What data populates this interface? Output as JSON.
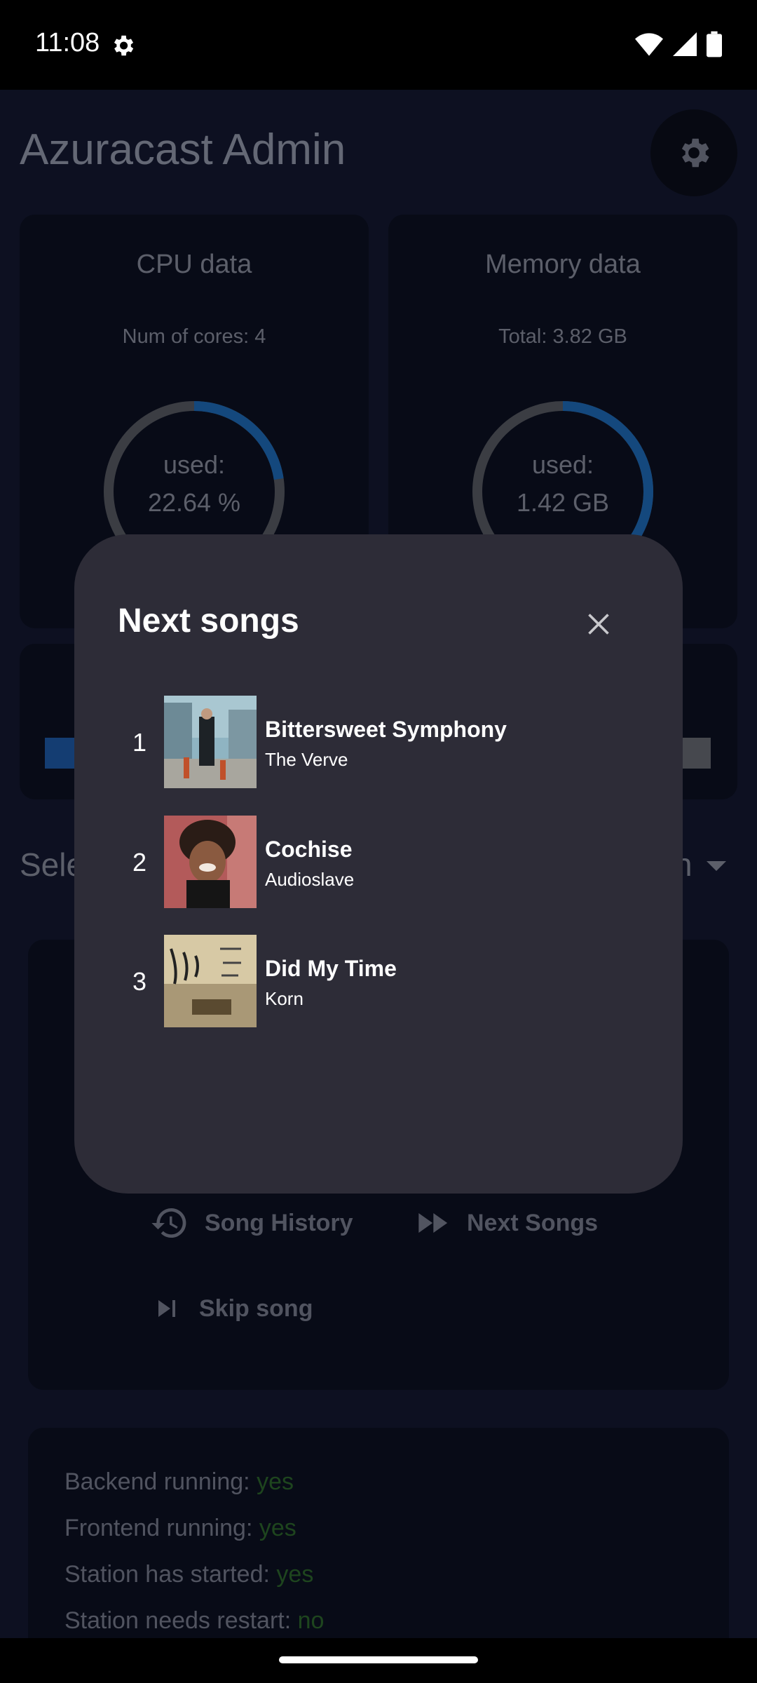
{
  "status_bar": {
    "time": "11:08"
  },
  "app": {
    "title": "Azuracast Admin",
    "cpu_card": {
      "title": "CPU data",
      "subtitle": "Num of cores: 4",
      "used_label": "used:",
      "used_value": "22.64 %",
      "used_fraction": 0.2264
    },
    "memory_card": {
      "title": "Memory data",
      "subtitle": "Total: 3.82 GB",
      "used_label": "used:",
      "used_value": "1.42 GB",
      "used_fraction": 0.37
    },
    "select_label": "Sele",
    "select_tail": "n",
    "actions": {
      "song_history": "Song History",
      "next_songs": "Next Songs",
      "skip_song": "Skip song"
    },
    "status": {
      "backend_label": "Backend running:",
      "backend_value": "yes",
      "frontend_label": "Frontend running:",
      "frontend_value": "yes",
      "started_label": "Station has started:",
      "started_value": "yes",
      "restart_label": "Station needs restart:",
      "restart_value": "no"
    }
  },
  "dialog": {
    "title": "Next songs",
    "songs": [
      {
        "number": "1",
        "title": "Bittersweet Symphony",
        "artist": "The Verve"
      },
      {
        "number": "2",
        "title": "Cochise",
        "artist": "Audioslave"
      },
      {
        "number": "3",
        "title": "Did My Time",
        "artist": "Korn"
      }
    ]
  },
  "colors": {
    "accent": "#1f6fc0",
    "gauge_track": "#5b5f68",
    "status_ok": "#2f6b2f",
    "dialog_bg": "#2d2c37"
  }
}
